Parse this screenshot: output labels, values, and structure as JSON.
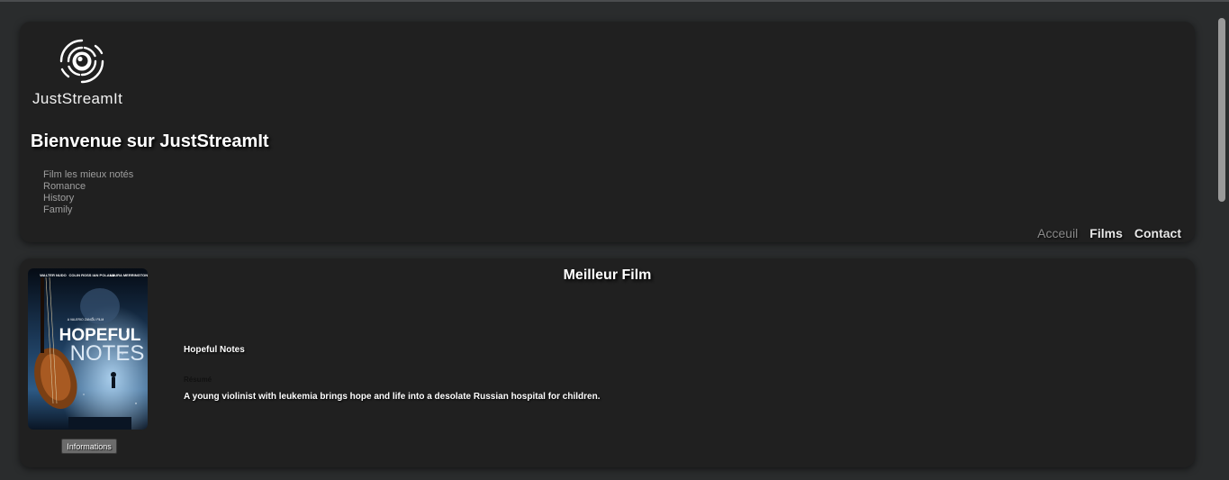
{
  "header": {
    "logo_text": "JustStreamIt",
    "welcome": "Bienvenue sur JustStreamIt",
    "categories": [
      "Film les mieux notés",
      "Romance",
      "History",
      "Family"
    ],
    "nav": [
      {
        "label": "Acceuil",
        "active": true
      },
      {
        "label": "Films",
        "active": false
      },
      {
        "label": "Contact",
        "active": false
      }
    ]
  },
  "best_film": {
    "section_title": "Meilleur Film",
    "title": "Hopeful Notes",
    "resume_label": "Résumé",
    "resume": "A young violinist with leukemia brings hope and life into a desolate Russian hospital for children.",
    "info_button": "Informations",
    "poster": {
      "cast": [
        "WALTER NUDO",
        "COLIN ROSS",
        "IAN POLAND",
        "LAURA MERRINGTON"
      ],
      "title_line1": "HOPEFUL",
      "title_line2": "NOTES",
      "credit": "A VALERIO ZANOLI FILM"
    }
  },
  "colors": {
    "page_bg": "#2a2c2d",
    "card_bg": "#202020",
    "muted_text": "#9e9e9e",
    "nav_active": "#8a8a8a"
  }
}
